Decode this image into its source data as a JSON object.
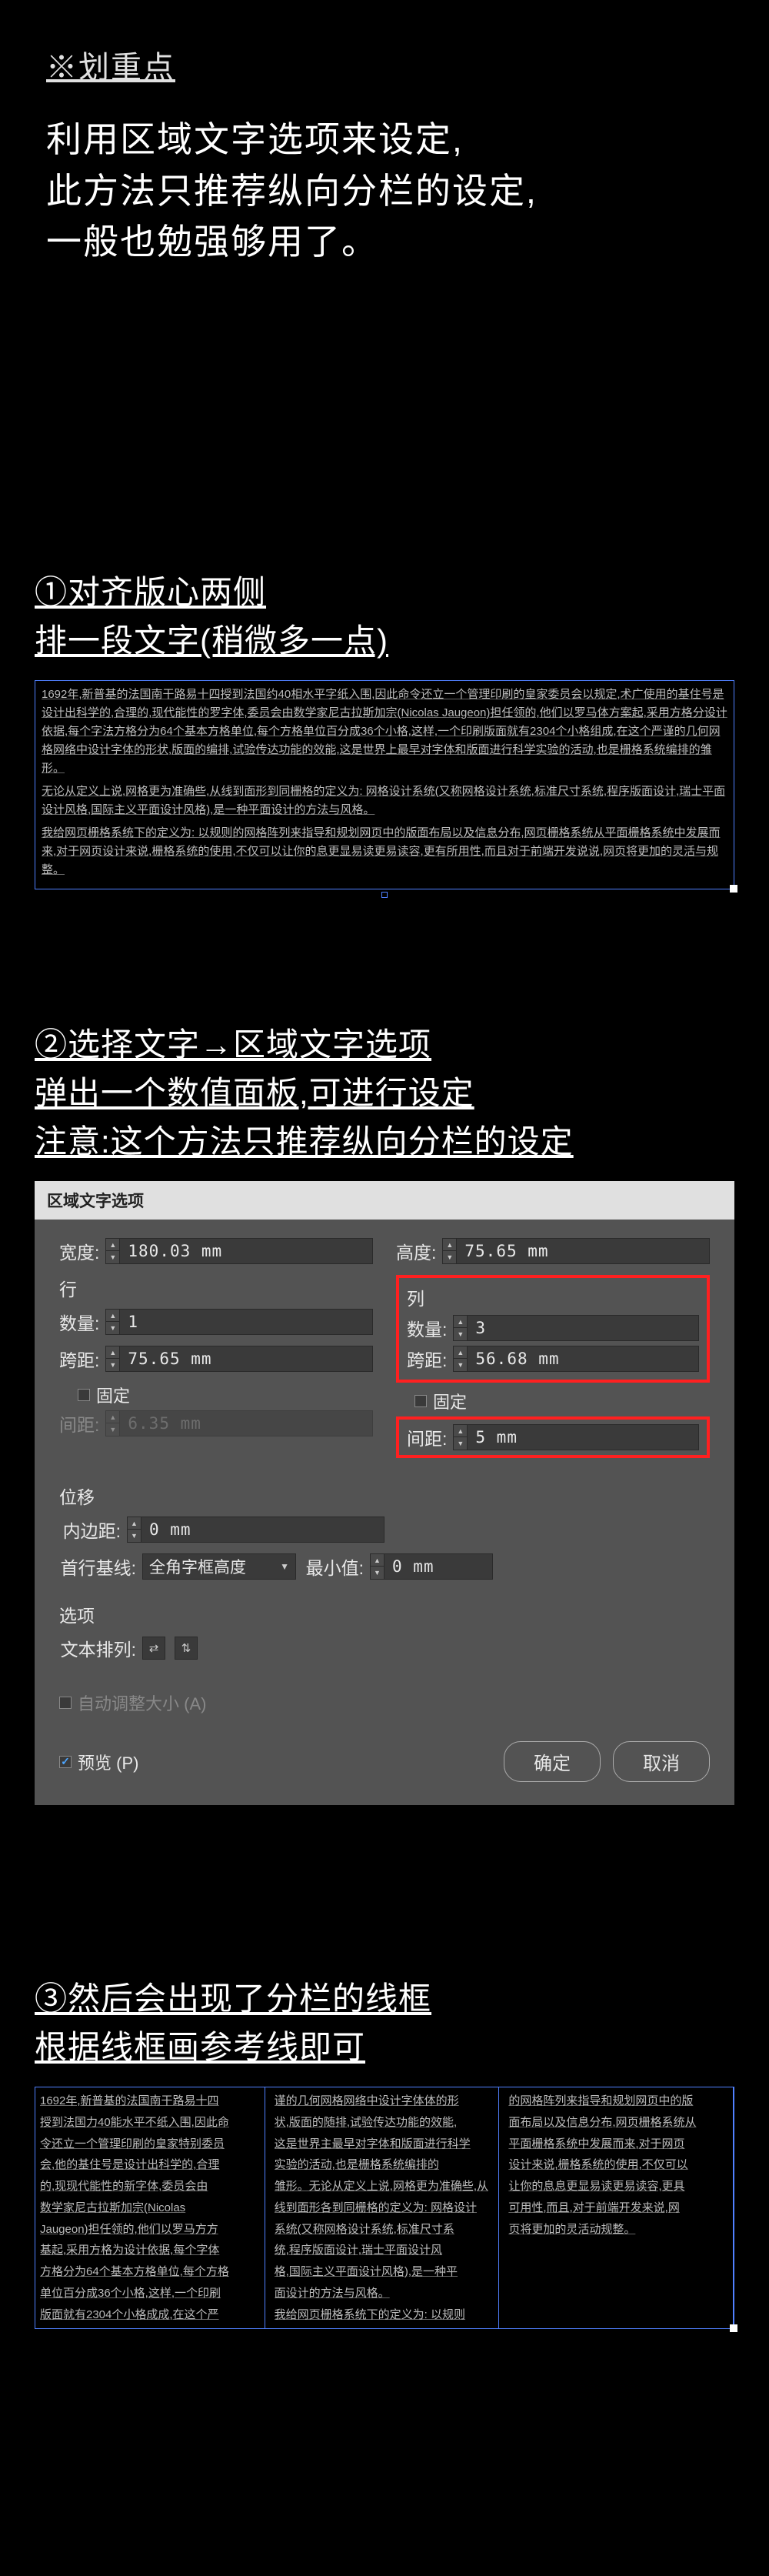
{
  "header": {
    "keypoint": "※划重点",
    "intro_line1": "利用区域文字选项来设定,",
    "intro_line2": "此方法只推荐纵向分栏的设定,",
    "intro_line3": "一般也勉强够用了。"
  },
  "step1": {
    "title_line1": "①对齐版心两侧",
    "title_line2": "排一段文字(稍微多一点)",
    "filler": [
      "1692年,新普基的法国南干路易十四授到法国约40相水平字纸入围,因此命令还立一个管理印刷的皇家委员会以规定,术广使用的基住号是设计出科学的,合理的,现代能性的罗字体,委员会由数学家尼古拉斯加宗(Nicolas Jaugeon)担任领的,他们以罗马体方案起,采用方格分设计依据,每个字法方格分为64个基本方格单位,每个方格单位百分成36个小格,这样,一个印刷版面就有2304个小格组成,在这个严谨的几何网格网络中设计字体的形状,版面的编排,试验传达功能的效能,这是世界上最早对字体和版面进行科学实验的活动,也是栅格系统编排的雏形。",
      "无论从定义上说,网格更为准确些,从线到面形到同栅格的定义为: 网格设计系统(又称网格设计系统,标准尺寸系统,程序版面设计,瑞士平面设计风格,国际主义平面设计风格),是一种平面设计的方法与风格。",
      "我给网页栅格系统下的定义为: 以规则的网格阵列来指导和规划网页中的版面布局以及信息分布,网页栅格系统从平面栅格系统中发展而来,对于网页设计来说,栅格系统的使用,不仅可以让你的息更显易读更易读容,更有所用性,而且对于前端开发说说,网页将更加的灵活与规整。"
    ]
  },
  "step2": {
    "title_line1": "②选择文字→区域文字选项",
    "title_line2": "弹出一个数值面板,可进行设定",
    "title_line3": "注意:这个方法只推荐纵向分栏的设定"
  },
  "dialog": {
    "title": "区域文字选项",
    "width_label": "宽度:",
    "width_value": "180.03 mm",
    "height_label": "高度:",
    "height_value": "75.65 mm",
    "row_section": "行",
    "col_section": "列",
    "count_label": "数量:",
    "row_count": "1",
    "col_count": "3",
    "span_label": "跨距:",
    "row_span": "75.65 mm",
    "col_span": "56.68 mm",
    "fixed_label": "固定",
    "gap_label": "间距:",
    "row_gap": "6.35 mm",
    "col_gap": "5 mm",
    "offset_section": "位移",
    "inset_label": "内边距:",
    "inset_value": "0 mm",
    "baseline_label": "首行基线:",
    "baseline_value": "全角字框高度",
    "min_label": "最小值:",
    "min_value": "0 mm",
    "options_section": "选项",
    "text_flow_label": "文本排列:",
    "auto_size": "自动调整大小 (A)",
    "preview": "预览 (P)",
    "ok": "确定",
    "cancel": "取消"
  },
  "step3": {
    "title_line1": "③然后会出现了分栏的线框",
    "title_line2": "根据线框画参考线即可",
    "col_lines": [
      [
        "1692年,新普基的法国南干路易十四",
        "授到法国力40能水平不纸入围,因此命",
        "令还立一个管理印刷的皇家特别委员",
        "会,他的基住号是设计出科学的,合理",
        "的,现现代能性的新字体,委员会由",
        "数学家尼古拉斯加宗(Nicolas",
        "Jaugeon)担任领的,他们以罗马方方",
        "基起,采用方格为设计依据,每个字体",
        "方格分为64个基本方格单位,每个方格",
        "单位百分成36个小格,这样,一个印刷",
        "版面就有2304个小格成成,在这个严"
      ],
      [
        "谨的几何网格网络中设计字体体的形",
        "状,版面的随排,试验传达功能的效能,",
        "这是世界主最早对字体和版面进行科学",
        "实验的活动,也是栅格系统编排的",
        "雏形。无论从定义上说,网格更为准确些,从",
        "线到面形各到同栅格的定义为: 网格设计",
        "系统(又称网格设计系统,标准尺寸系",
        "统,程序版面设计,瑞士平面设计风",
        "格,国际主义平面设计风格),是一种平",
        "面设计的方法与风格。",
        "我给网页栅格系统下的定义为: 以规则"
      ],
      [
        "的网格阵列来指导和规划网页中的版",
        "面布局以及信息分布,网页栅格系统从",
        "平面栅格系统中发展而来,对于网页",
        "设计来说,栅格系统的使用,不仅可以",
        "让你的息息更显易读更易读容,更具",
        "可用性,而且,对于前端开发来说,网",
        "页将更加的灵活动规整。"
      ]
    ]
  }
}
